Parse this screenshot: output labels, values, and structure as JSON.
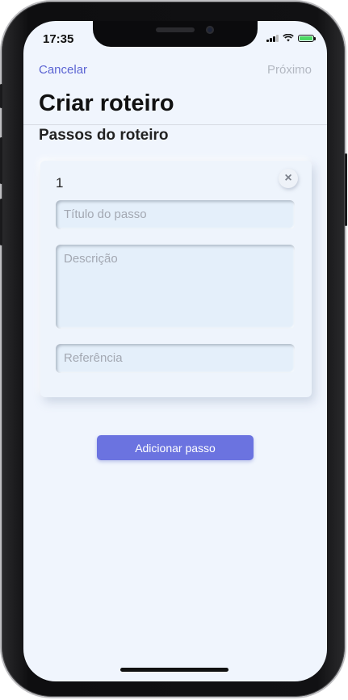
{
  "status_bar": {
    "time": "17:35"
  },
  "nav": {
    "cancel_label": "Cancelar",
    "next_label": "Próximo"
  },
  "page": {
    "title": "Criar roteiro",
    "section_title": "Passos do roteiro"
  },
  "step": {
    "number": "1",
    "remove_icon": "×",
    "title_placeholder": "Título do passo",
    "description_placeholder": "Descrição",
    "reference_placeholder": "Referência"
  },
  "actions": {
    "add_step_label": "Adicionar passo"
  },
  "colors": {
    "accent": "#6b73e0",
    "link": "#5b64d3",
    "background": "#f0f5fd"
  }
}
